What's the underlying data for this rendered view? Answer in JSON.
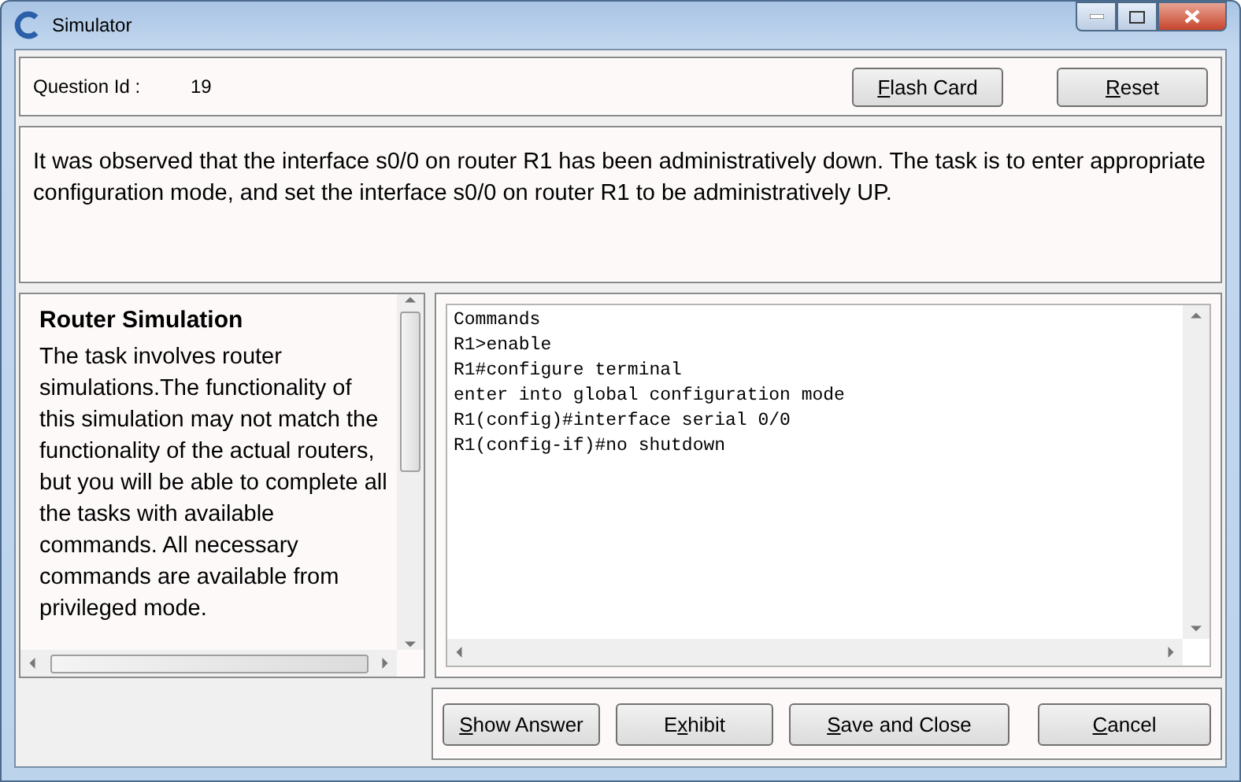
{
  "window": {
    "title": "Simulator"
  },
  "header": {
    "label": "Question Id :",
    "value": "19",
    "buttons": [
      {
        "key": "F",
        "after": "lash Card"
      },
      {
        "key": "R",
        "after": "eset"
      }
    ]
  },
  "question": "It was observed that the interface s0/0 on router R1 has been administratively down. The task is to enter appropriate configuration mode, and set the interface s0/0 on router R1 to be administratively UP.",
  "info": {
    "title": "Router Simulation",
    "body": "The task involves router simulations.The functionality of this simulation may not match the functionality of the actual routers, but you will be able to complete all the tasks with available commands. All necessary commands are available from privileged mode."
  },
  "console": {
    "lines": [
      "Commands",
      "R1>enable",
      "R1#configure terminal",
      "enter into global configuration mode",
      "R1(config)#interface serial 0/0",
      "R1(config-if)#no shutdown"
    ]
  },
  "footer": {
    "buttons": [
      {
        "key": "S",
        "after": "how Answer"
      },
      {
        "before": "E",
        "key": "x",
        "after": "hibit"
      },
      {
        "key": "S",
        "after": "ave and Close"
      },
      {
        "key": "C",
        "after": "ancel"
      }
    ]
  }
}
